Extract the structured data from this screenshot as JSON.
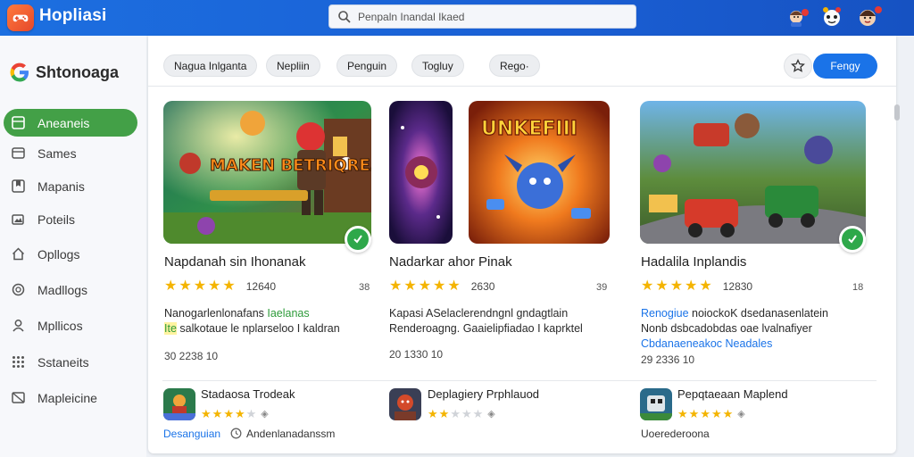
{
  "app": {
    "title": "Hopliasi",
    "logo_icon": "game-controller-icon",
    "accent": "#1a73e8",
    "topbar_color": "#1a5fd4"
  },
  "search": {
    "placeholder": "Penpaln Inandal Ikaed",
    "icon": "search-icon"
  },
  "sidebar": {
    "brand": "Shtonoaga",
    "items": [
      {
        "label": "Aneaneis",
        "icon": "grid-icon",
        "active": true
      },
      {
        "label": "Sames",
        "icon": "card-icon",
        "active": false
      },
      {
        "label": "Mapanis",
        "icon": "bookmark-icon",
        "active": false
      },
      {
        "label": "Poteils",
        "icon": "image-icon",
        "active": false
      },
      {
        "label": "Opllogs",
        "icon": "home-icon",
        "active": false
      },
      {
        "label": "Madllogs",
        "icon": "coin-icon",
        "active": false
      },
      {
        "label": "Mpllicos",
        "icon": "person-icon",
        "active": false
      },
      {
        "label": "Sstaneits",
        "icon": "apps-icon",
        "active": false
      },
      {
        "label": "Mapleicine",
        "icon": "box-icon",
        "active": false
      }
    ]
  },
  "toolbar": {
    "chips": [
      "Nagua Inlganta",
      "Nepliin",
      "Penguin",
      "Togluy",
      "Rego·"
    ],
    "star_icon": "star-outline-icon",
    "primary_label": "Fengy"
  },
  "cards": [
    {
      "title": "Napdanah sin Ihonanak",
      "rating": 5,
      "rating_count": "12640",
      "side": "38",
      "desc_line1": "Nanogarlenlonafans",
      "desc_line1_hl": "Iaelanas",
      "desc_line2_hl": "Ite",
      "desc_line2": "salkotaue le nplarseloo I kaldran",
      "meta": "30 2238 10",
      "art_text": "MAKEN BETRIQREAI",
      "badge_icon": "verified-badge-icon"
    },
    {
      "title": "Nadarkar ahor Pinak",
      "rating": 4.5,
      "rating_count": "2630",
      "side": "39",
      "desc_line1": "Kapasi ASelaclerendngnl gndagtlain",
      "desc_line2": "Renderoagng. Gaaielipfiadao I kaprktel",
      "meta": "20 1330 10",
      "art_text": "UNKEFIII"
    },
    {
      "title": "Hadalila Inplandis",
      "rating": 4.5,
      "rating_count": "12830",
      "side": "18",
      "desc_line1_hl": "Renogiue",
      "desc_line1": "noiockoK dsedanasenlatein",
      "desc_line2": "Nonb dsbcadobdas oae lvalnafiyer",
      "desc_line3_hl": "Cbdanaeneakoc",
      "desc_line3_hl2": "Neadales",
      "meta": "29 2336 10",
      "badge_icon": "verified-badge-icon"
    }
  ],
  "mini_list": [
    {
      "title": "Stadaosa Trodeak",
      "rating": 4,
      "sub_hl": "Desanguian",
      "sub_icon": "clock-icon",
      "sub": "Andenlanadanssm"
    },
    {
      "title": "Deplagiery Prphlauod",
      "rating": 2,
      "sub": ""
    },
    {
      "title": "Pepqtaeaan Maplend",
      "rating": 5,
      "sub": "Uoerederoona"
    }
  ]
}
